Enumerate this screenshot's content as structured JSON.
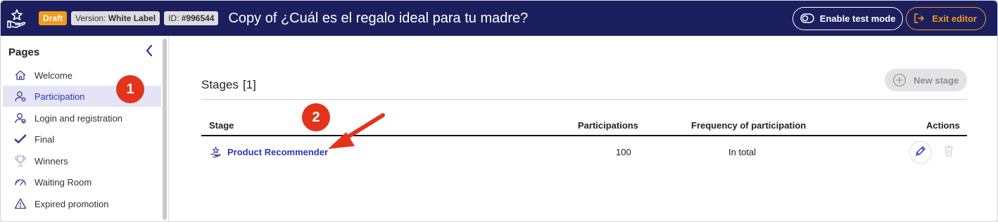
{
  "topbar": {
    "status_badge": "Draft",
    "version_label": "Version:",
    "version_value": "White Label",
    "id_label": "ID:",
    "id_value": "#996544",
    "title": "Copy of ¿Cuál es el regalo ideal para tu madre?",
    "test_mode_label": "Enable test mode",
    "exit_label": "Exit editor"
  },
  "sidebar": {
    "heading": "Pages",
    "items": [
      {
        "label": "Welcome",
        "icon": "home-icon"
      },
      {
        "label": "Participation",
        "icon": "user-cog-icon",
        "active": true
      },
      {
        "label": "Login and registration",
        "icon": "user-login-icon"
      },
      {
        "label": "Final",
        "icon": "check-icon"
      },
      {
        "label": "Winners",
        "icon": "trophy-icon"
      },
      {
        "label": "Waiting Room",
        "icon": "gauge-icon"
      },
      {
        "label": "Expired promotion",
        "icon": "warning-icon"
      }
    ]
  },
  "annotations": {
    "step1": "1",
    "step2": "2",
    "arrow_color": "#e2331d"
  },
  "main": {
    "stages_title": "Stages",
    "stages_count": "[1]",
    "new_stage_label": "New stage",
    "columns": {
      "stage": "Stage",
      "participations": "Participations",
      "frequency": "Frequency of participation",
      "actions": "Actions"
    },
    "rows": [
      {
        "stage": "Product Recommender",
        "participations": "100",
        "frequency": "In total"
      }
    ]
  },
  "colors": {
    "navbar": "#1c1f5e",
    "accent": "#2d35b8",
    "draft": "#f39a1c",
    "annotation": "#e2331d"
  }
}
